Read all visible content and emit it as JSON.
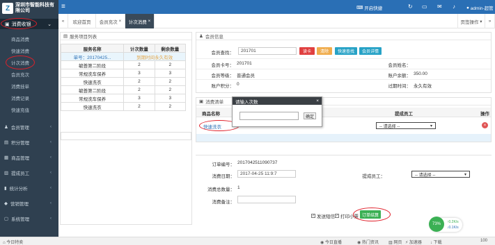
{
  "company": {
    "logo_letter": "Z",
    "name_line1": "深圳市智能科技有",
    "name_line2": "限公司"
  },
  "sidebar": {
    "active_group": "消费收银",
    "sub_items": [
      "商品消费",
      "快速消费",
      "计次消费",
      "会员充次",
      "消费挂单",
      "消费记录",
      "快速充值"
    ],
    "groups": [
      "会员管理",
      "积分管理",
      "商品管理",
      "提成员工",
      "统计分析",
      "营销管理",
      "系统管理"
    ]
  },
  "topbar": {
    "shift": "开启快捷",
    "user": "admin-超管"
  },
  "tabs": {
    "home": "欢迎首页",
    "t1": "会员充次",
    "t2": "计次消费",
    "page_ops": "页签操作"
  },
  "service_panel": {
    "title": "服务项目列表",
    "headers": [
      "服务名称",
      "计次数量",
      "剩余数量"
    ],
    "card_row": {
      "card": "单号：20170425...",
      "status": "到期时间永久有效"
    },
    "rows": [
      [
        "毓荟第二阶段",
        "2",
        "2"
      ],
      [
        "常规洗车保养",
        "3",
        "3"
      ],
      [
        "快速洗衣",
        "2",
        "2"
      ],
      [
        "毓荟第二阶段",
        "2",
        "2"
      ],
      [
        "常规洗车保养",
        "3",
        "3"
      ],
      [
        "快速洗衣",
        "2",
        "2"
      ]
    ]
  },
  "member_panel": {
    "title": "会员信息",
    "search_label": "会员查找：",
    "search_value": "201701",
    "btn_read": "读卡",
    "btn_clear": "清除",
    "btn_quick": "快速查找",
    "btn_detail": "会员详情",
    "card_label": "会员卡号：",
    "card_value": "201701",
    "name_label": "会员姓名：",
    "name_value": "",
    "level_label": "会员等级：",
    "level_value": "普通会员",
    "balance_label": "账户余额：",
    "balance_value": "350.00",
    "points_label": "账户积分：",
    "points_value": "0",
    "expire_label": "过期时间：",
    "expire_value": "永久有效"
  },
  "sale_panel": {
    "title": "消费清单",
    "col_product": "商品名称",
    "col_staff": "提成员工",
    "col_op": "操作",
    "product": "快速洗衣",
    "staff_select": "-- 请选择 --"
  },
  "dialog": {
    "title": "请输入次数",
    "confirm": "确定"
  },
  "order": {
    "no_label": "订单编号：",
    "no_value": "2017042511090737",
    "date_label": "消费日期：",
    "date_value": "2017-04-25 11:9:7",
    "staff_label": "提成员工：",
    "staff_select": "-- 请选择 --",
    "total_label": "消费总数量：",
    "total_value": "1",
    "note_label": "消费备注：",
    "sms": "发送短信",
    "print": "打印小票",
    "submit": "订单结算"
  },
  "widget": {
    "percent": "73%",
    "up": "0.2K/s",
    "down": "0.1K/s"
  },
  "footer": {
    "left": "今日特卖",
    "items": [
      "今日直播",
      "热门资讯",
      "网页",
      "加速器",
      "下载",
      "100"
    ]
  },
  "colors": {
    "sidebar": "#2f4050",
    "topbar": "#2a6fb5",
    "read": "#e04040",
    "clear": "#f0ad4e",
    "info": "#27a2c6",
    "submit": "#3bb054"
  }
}
